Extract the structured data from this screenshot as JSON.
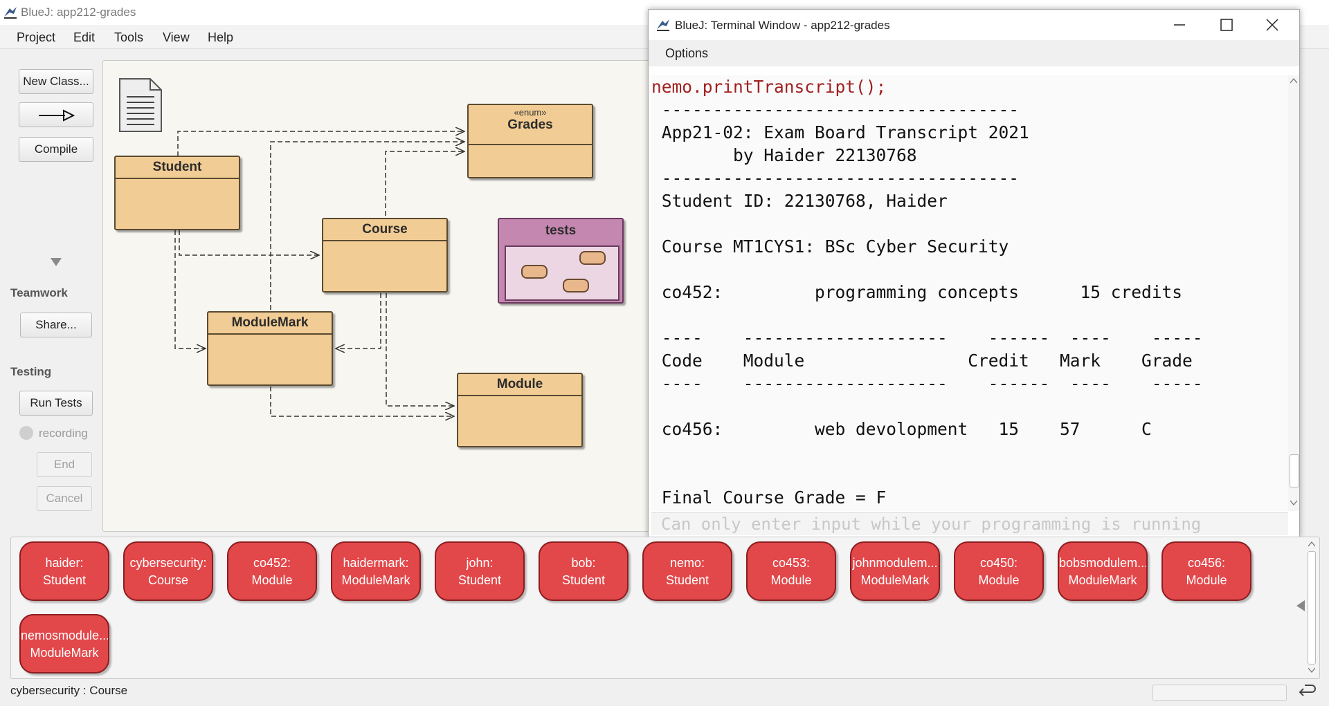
{
  "app": {
    "title": "BlueJ:  app212-grades",
    "menu": [
      "Project",
      "Edit",
      "Tools",
      "View",
      "Help"
    ]
  },
  "sidebar": {
    "new_class": "New Class...",
    "compile": "Compile",
    "teamwork_label": "Teamwork",
    "share": "Share...",
    "testing_label": "Testing",
    "run_tests": "Run Tests",
    "recording": "recording",
    "end": "End",
    "cancel": "Cancel"
  },
  "diagram": {
    "classes": {
      "grades_stereotype": "«enum»",
      "grades": "Grades",
      "student": "Student",
      "course": "Course",
      "tests": "tests",
      "modulemark": "ModuleMark",
      "module": "Module"
    }
  },
  "terminal": {
    "title": "BlueJ: Terminal Window - app212-grades",
    "options_menu": "Options",
    "command": "nemo.printTranscript();",
    "lines": [
      " -----------------------------------",
      " App21-02: Exam Board Transcript 2021",
      "        by Haider 22130768",
      " -----------------------------------",
      " Student ID: 22130768, Haider",
      "",
      " Course MT1CYS1: BSc Cyber Security",
      "",
      " co452:         programming concepts      15 credits",
      "",
      " ----    --------------------    ------  ----    -----",
      " Code    Module                Credit   Mark    Grade",
      " ----    --------------------    ------  ----    -----",
      "",
      " co456:         web devolopment   15    57      C",
      "",
      "",
      " Final Course Grade = F"
    ],
    "input_placeholder": "Can only enter input while your programming is running"
  },
  "object_bench": {
    "objects": [
      {
        "name": "haider:",
        "type": "Student"
      },
      {
        "name": "cybersecurity:",
        "type": "Course"
      },
      {
        "name": "co452:",
        "type": "Module"
      },
      {
        "name": "haidermark:",
        "type": "ModuleMark"
      },
      {
        "name": "john:",
        "type": "Student"
      },
      {
        "name": "bob:",
        "type": "Student"
      },
      {
        "name": "nemo:",
        "type": "Student"
      },
      {
        "name": "co453:",
        "type": "Module"
      },
      {
        "name": "johnmodulem...",
        "type": "ModuleMark"
      },
      {
        "name": "co450:",
        "type": "Module"
      },
      {
        "name": "bobsmodulem...",
        "type": "ModuleMark"
      },
      {
        "name": "co456:",
        "type": "Module"
      },
      {
        "name": "nemosmodule...",
        "type": "ModuleMark"
      }
    ]
  },
  "status": {
    "text": "cybersecurity : Course"
  }
}
